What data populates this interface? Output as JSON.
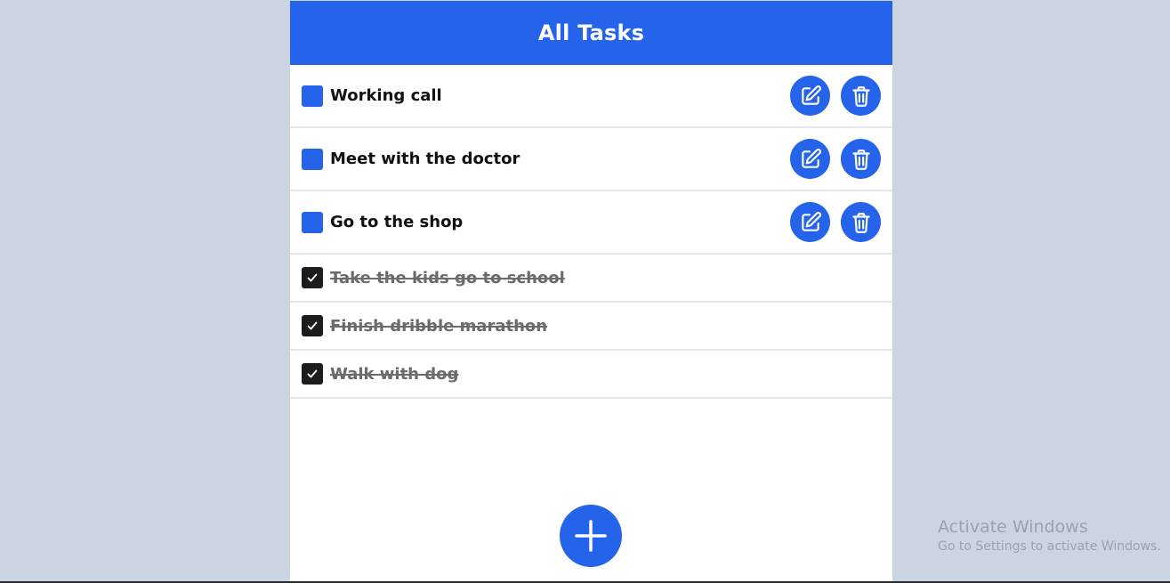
{
  "header": {
    "title": "All Tasks"
  },
  "tasks_active": [
    {
      "label": "Working call"
    },
    {
      "label": "Meet with the doctor"
    },
    {
      "label": "Go to the shop"
    }
  ],
  "tasks_done": [
    {
      "label": "Take the kids go to school"
    },
    {
      "label": "Finish dribble marathon"
    },
    {
      "label": "Walk with dog"
    }
  ],
  "icons": {
    "edit": "edit-icon",
    "delete": "trash-icon",
    "check": "check-icon",
    "add": "plus-icon"
  },
  "colors": {
    "accent": "#2563eb",
    "background": "#cbd5e1",
    "checked_box": "#1c1c1c"
  },
  "watermark": {
    "title": "Activate Windows",
    "subtitle": "Go to Settings to activate Windows."
  }
}
